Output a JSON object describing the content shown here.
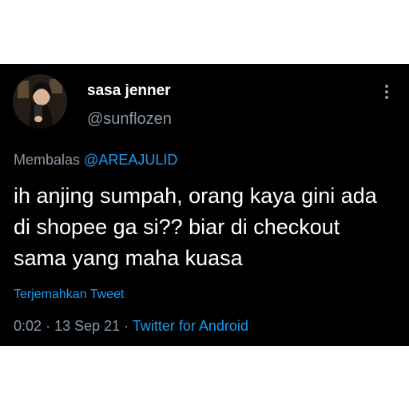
{
  "tweet": {
    "display_name": "sasa jenner",
    "handle": "@sunflozen",
    "reply_prefix": "Membalas",
    "reply_to": "@AREAJULID",
    "text": "ih anjing sumpah, orang kaya gini ada di shopee ga si?? biar di checkout sama yang maha kuasa",
    "translate_label": "Terjemahkan Tweet",
    "time": "0:02",
    "date": "13 Sep 21",
    "separator": "·",
    "source": "Twitter for Android"
  },
  "icons": {
    "more": "more-vertical-icon",
    "avatar": "profile-photo"
  },
  "colors": {
    "background": "#000000",
    "primary_text": "#ffffff",
    "secondary_text": "#8b98a5",
    "accent": "#1d9bf0"
  }
}
